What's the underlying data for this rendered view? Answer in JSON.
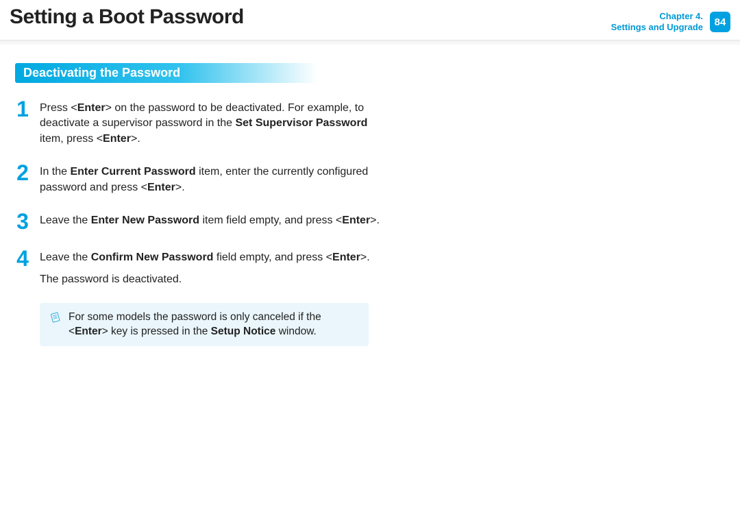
{
  "header": {
    "title": "Setting a Boot Password",
    "chapter_line1": "Chapter 4.",
    "chapter_line2": "Settings and Upgrade",
    "page_number": "84"
  },
  "section": {
    "heading": "Deactivating the Password"
  },
  "steps": [
    {
      "num": "1",
      "html": "Press &lt;<b>Enter</b>&gt; on the password to be deactivated. For example, to deactivate a supervisor password in the <b>Set Supervisor Password</b> item, press &lt;<b>Enter</b>&gt;."
    },
    {
      "num": "2",
      "html": "In the <b>Enter Current Password</b> item, enter the currently configured password and press &lt;<b>Enter</b>&gt;."
    },
    {
      "num": "3",
      "html": "Leave the <b>Enter New Password</b> item field empty, and press &lt;<b>Enter</b>&gt;."
    },
    {
      "num": "4",
      "html": "<p>Leave the <b>Confirm New Password</b> field empty, and press &lt;<b>Enter</b>&gt;.</p><p>The password is deactivated.</p>"
    }
  ],
  "note": {
    "html": "For some models the password is only canceled if the &lt;<b>Enter</b>&gt; key is pressed in the <b>Setup Notice</b> window."
  }
}
